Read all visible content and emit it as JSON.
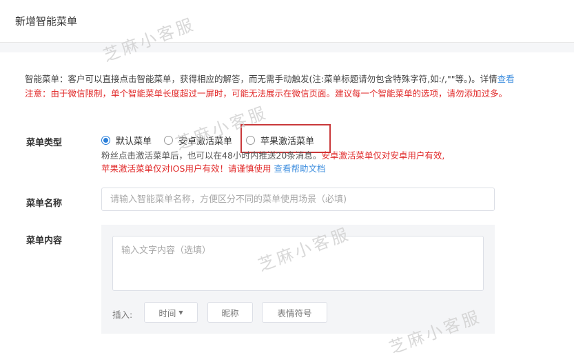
{
  "header": {
    "title": "新增智能菜单"
  },
  "notices": {
    "line1_text": "智能菜单：客户可以直接点击智能菜单，获得相应的解答，而无需手动触发(注:菜单标题请勿包含特殊字符,如:/,\"\"等。)。详情",
    "line1_link": "查看",
    "line2_text": "注意：由于微信限制，单个智能菜单长度超过一屏时，可能无法展示在微信页面。建议每一个智能菜单的选项，请勿添加过多。"
  },
  "menu_type": {
    "label": "菜单类型",
    "options": [
      {
        "label": "默认菜单",
        "checked": true
      },
      {
        "label": "安卓激活菜单",
        "checked": false
      },
      {
        "label": "苹果激活菜单",
        "checked": false
      }
    ],
    "help_line1_plain": "粉丝点击激活菜单后，也可以在48小时内推送20条消息。",
    "help_line1_red": "安卓激活菜单仅对安卓用户有效,",
    "help_line2_red": "苹果激活菜单仅对IOS用户有效！请谨慎使用",
    "help_line2_link": "查看帮助文档"
  },
  "menu_name": {
    "label": "菜单名称",
    "placeholder": "请输入智能菜单名称，方便区分不同的菜单使用场景（必填)"
  },
  "menu_content": {
    "label": "菜单内容",
    "placeholder": "输入文字内容（选填）",
    "insert_label": "插入:",
    "buttons": {
      "time": "时间",
      "nickname": "昵称",
      "emoji": "表情符号"
    }
  },
  "watermark": "芝麻小客服",
  "colors": {
    "accent_blue": "#2b7fd9",
    "link_blue": "#3c8dde",
    "warning_red": "#e12a2a",
    "highlight_red": "#c9383a"
  },
  "icons": {
    "dropdown": "caret-down-icon"
  }
}
